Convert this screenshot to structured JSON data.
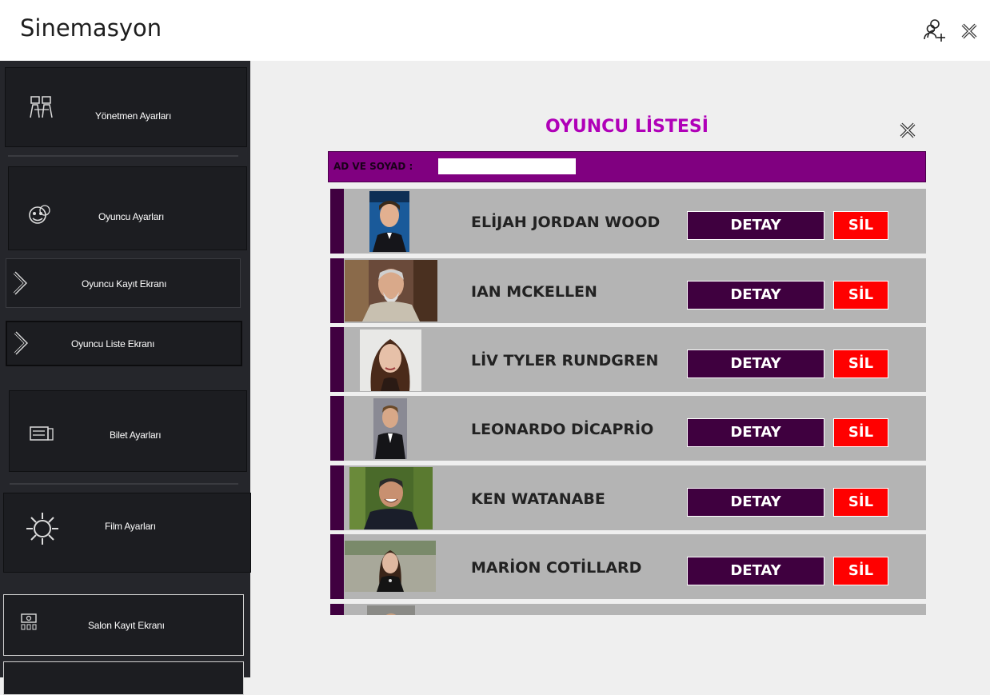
{
  "app": {
    "title": "Sinemasyon"
  },
  "titlebar": {
    "add_user_icon": "add-user-icon",
    "close_icon": "close-icon"
  },
  "sidebar": {
    "director_settings": "Yönetmen  Ayarları",
    "actor_settings": "Oyuncu Ayarları",
    "actor_register": "Oyuncu Kayıt Ekranı",
    "actor_list": "Oyuncu Liste Ekranı",
    "ticket_settings": "Bilet Ayarları",
    "film_settings": "Film Ayarları",
    "hall_register": "Salon Kayıt Ekranı"
  },
  "panel": {
    "title": "OYUNCU LİSTESİ",
    "search_label": "AD VE SOYAD :",
    "search_value": "",
    "detail_label": "DETAY",
    "delete_label": "SİL"
  },
  "actors": [
    {
      "name": "ELİJAH JORDAN WOOD"
    },
    {
      "name": "IAN MCKELLEN"
    },
    {
      "name": "LİV TYLER RUNDGREN"
    },
    {
      "name": "LEONARDO DİCAPRİO"
    },
    {
      "name": "KEN WATANABE"
    },
    {
      "name": "MARİON COTİLLARD"
    }
  ],
  "colors": {
    "accent_purple": "#800080",
    "title_magenta": "#b000b8",
    "detail_button": "#3f003f",
    "delete_button": "#ff0000",
    "sidebar_bg": "#25262b"
  }
}
